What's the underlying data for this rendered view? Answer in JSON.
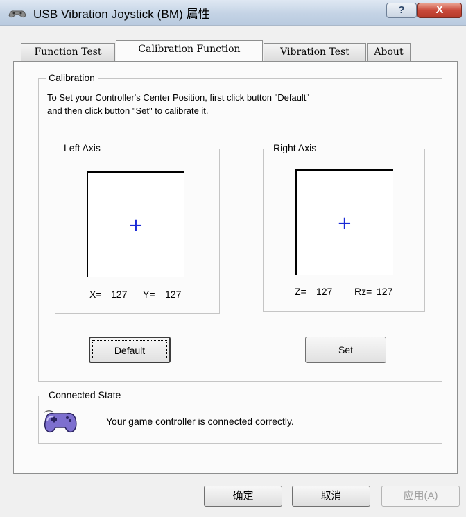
{
  "window": {
    "title": "USB Vibration Joystick (BM) 属性",
    "help_glyph": "?",
    "close_glyph": "X"
  },
  "tabs": [
    {
      "label": "Function Test"
    },
    {
      "label": "Calibration Function",
      "active": true
    },
    {
      "label": "Vibration Test"
    },
    {
      "label": "About"
    }
  ],
  "calibration": {
    "legend": "Calibration",
    "line1": "To Set your Controller's  Center Position, first click button \"Default\"",
    "line2": "and then click button \"Set\" to calibrate it.",
    "left_axis": {
      "legend": "Left Axis",
      "x_label": "X=",
      "x_value": "127",
      "y_label": "Y=",
      "y_value": "127"
    },
    "right_axis": {
      "legend": "Right Axis",
      "z_label": "Z=",
      "z_value": "127",
      "rz_label": "Rz=",
      "rz_value": "127"
    },
    "default_button": "Default",
    "set_button": "Set"
  },
  "connected": {
    "legend": "Connected State",
    "message": "Your game controller is connected correctly.",
    "icon": "gamepad-icon"
  },
  "footer": {
    "ok": "确定",
    "cancel": "取消",
    "apply": "应用(A)"
  },
  "colors": {
    "crosshair": "#1a2ad6",
    "gamepad": "#7d6fcf"
  }
}
